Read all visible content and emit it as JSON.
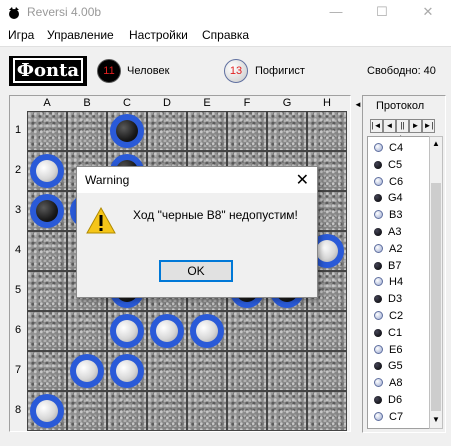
{
  "window": {
    "title": "Reversi 4.00b",
    "min": "—",
    "max": "☐",
    "close": "✕"
  },
  "menu": [
    "Игра",
    "Управление",
    "Настройки",
    "Справка"
  ],
  "logo": "Фonta",
  "players": {
    "black": {
      "count": "11",
      "name": "Человек"
    },
    "white": {
      "count": "13",
      "name": "Пофигист"
    }
  },
  "free": "Свободно: 40",
  "columns": [
    "A",
    "B",
    "C",
    "D",
    "E",
    "F",
    "G",
    "H"
  ],
  "rows": [
    "1",
    "2",
    "3",
    "4",
    "5",
    "6",
    "7",
    "8"
  ],
  "discs": [
    {
      "cell": "C1",
      "color": "black"
    },
    {
      "cell": "A2",
      "color": "white"
    },
    {
      "cell": "C2",
      "color": "black"
    },
    {
      "cell": "A3",
      "color": "black"
    },
    {
      "cell": "B3",
      "color": "white"
    },
    {
      "cell": "H4",
      "color": "white"
    },
    {
      "cell": "C5",
      "color": "black"
    },
    {
      "cell": "F5",
      "color": "black"
    },
    {
      "cell": "G5",
      "color": "black"
    },
    {
      "cell": "C6",
      "color": "white"
    },
    {
      "cell": "D6",
      "color": "white"
    },
    {
      "cell": "E6",
      "color": "white"
    },
    {
      "cell": "B7",
      "color": "white"
    },
    {
      "cell": "C7",
      "color": "white"
    },
    {
      "cell": "A8",
      "color": "white"
    }
  ],
  "protocol": {
    "title": "Протокол",
    "nav": [
      "|◄",
      "◄",
      "||►",
      "►",
      "►|"
    ],
    "moves": [
      {
        "color": "white",
        "move": "C4"
      },
      {
        "color": "black",
        "move": "C5"
      },
      {
        "color": "white",
        "move": "C6"
      },
      {
        "color": "black",
        "move": "G4"
      },
      {
        "color": "white",
        "move": "B3"
      },
      {
        "color": "black",
        "move": "A3"
      },
      {
        "color": "white",
        "move": "A2"
      },
      {
        "color": "black",
        "move": "B7"
      },
      {
        "color": "white",
        "move": "H4"
      },
      {
        "color": "black",
        "move": "D3"
      },
      {
        "color": "white",
        "move": "C2"
      },
      {
        "color": "black",
        "move": "C1"
      },
      {
        "color": "white",
        "move": "E6"
      },
      {
        "color": "black",
        "move": "G5"
      },
      {
        "color": "white",
        "move": "A8"
      },
      {
        "color": "black",
        "move": "D6"
      },
      {
        "color": "white",
        "move": "C7"
      }
    ]
  },
  "dialog": {
    "title": "Warning",
    "message": "Ход \"черные B8\" недопустим!",
    "ok": "OK"
  },
  "colors": {
    "disc_ring": "#2a5ad8",
    "board": "#8a8a8a",
    "accent": "#0078d7"
  }
}
